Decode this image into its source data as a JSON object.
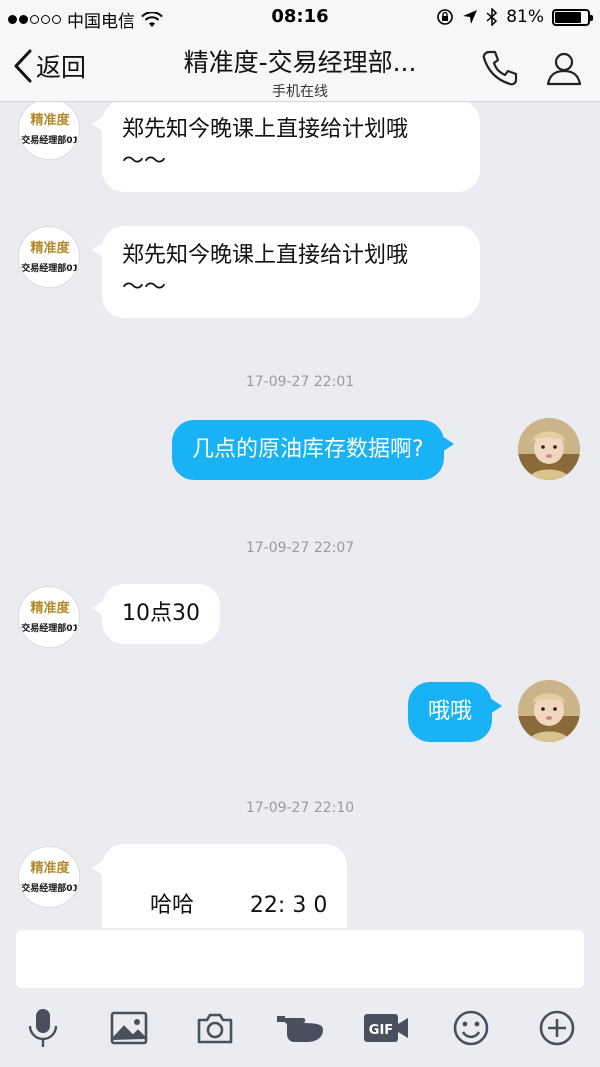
{
  "status": {
    "carrier": "中国电信",
    "time": "08:16",
    "battery": "81%",
    "battery_level": 0.81
  },
  "nav": {
    "back_label": "返回",
    "title": "精准度-交易经理部...",
    "subtitle": "手机在线"
  },
  "contact": {
    "brand_name": "精准度",
    "brand_caption": "交易经理部01"
  },
  "messages": [
    {
      "dir": "in",
      "text_line1": "郑先知今晚课上直接给计划哦",
      "text_line2": "～～"
    },
    {
      "dir": "in",
      "text_line1": "郑先知今晚课上直接给计划哦",
      "text_line2": "～～"
    },
    {
      "type": "timestamp",
      "text": "17-09-27 22:01"
    },
    {
      "dir": "out",
      "text": "几点的原油库存数据啊?"
    },
    {
      "type": "timestamp",
      "text": "17-09-27 22:07"
    },
    {
      "dir": "in",
      "text": "10点30"
    },
    {
      "dir": "out",
      "text": "哦哦"
    },
    {
      "type": "timestamp",
      "text": "17-09-27 22:10"
    },
    {
      "dir": "in",
      "text": "哈哈        22: 3 0"
    }
  ],
  "input": {
    "placeholder": ""
  },
  "toolbar": {
    "icons": [
      "microphone-icon",
      "image-icon",
      "camera-icon",
      "poke-hand-icon",
      "gif-icon",
      "emoji-icon",
      "plus-icon"
    ],
    "gif_label": "GIF"
  },
  "colors": {
    "accent": "#19b2f5",
    "background": "#ebecf1",
    "icon": "#4a4f5e"
  }
}
